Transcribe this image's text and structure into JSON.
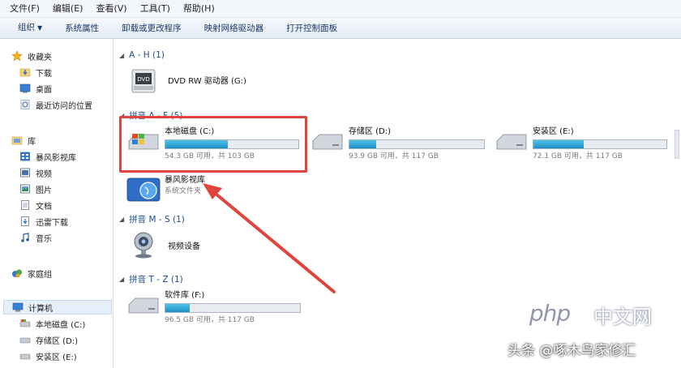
{
  "menubar": {
    "items": [
      "文件(F)",
      "编辑(E)",
      "查看(V)",
      "工具(T)",
      "帮助(H)"
    ]
  },
  "toolbar": {
    "items": [
      "组织",
      "系统属性",
      "卸载或更改程序",
      "映射网络驱动器",
      "打开控制面板"
    ]
  },
  "sidebar": {
    "favorites_label": "收藏夹",
    "favorites": [
      "下载",
      "桌面",
      "最近访问的位置"
    ],
    "libraries_label": "库",
    "libraries": [
      "暴风影视库",
      "视频",
      "图片",
      "文档",
      "迅雷下载",
      "音乐"
    ],
    "homegroup_label": "家庭组",
    "computer_label": "计算机",
    "computer_items": [
      "本地磁盘 (C:)",
      "存储区 (D:)",
      "安装区 (E:)"
    ]
  },
  "groups": [
    {
      "title": "A - H (1)"
    },
    {
      "title": "拼音 A - F (5)"
    },
    {
      "title": "拼音 M - S (1)"
    },
    {
      "title": "拼音 T - Z (1)"
    }
  ],
  "drives": {
    "dvd": {
      "name": "DVD RW 驱动器 (G:)"
    },
    "c": {
      "name": "本地磁盘 (C:)",
      "size": "54.3 GB 可用，共 103 GB",
      "used": 0.47
    },
    "d": {
      "name": "存储区 (D:)",
      "size": "93.9 GB 可用，共 117 GB",
      "used": 0.2
    },
    "e": {
      "name": "安装区 (E:)",
      "size": "72.1 GB 可用，共 117 GB",
      "used": 0.38
    },
    "storm": {
      "name": "暴风影视库",
      "sub": "系统文件夹"
    },
    "camera": {
      "name": "视频设备"
    },
    "f": {
      "name": "软件库 (F:)",
      "size": "96.5 GB 可用，共 117 GB",
      "used": 0.18
    }
  },
  "watermark": {
    "php": "php",
    "cn": "中文网",
    "author": "头条 @啄木鸟家修汇"
  },
  "colors": {
    "highlight": "#e0443c",
    "bar_fill": "#1e8fc6",
    "group_header": "#1d4f91"
  }
}
